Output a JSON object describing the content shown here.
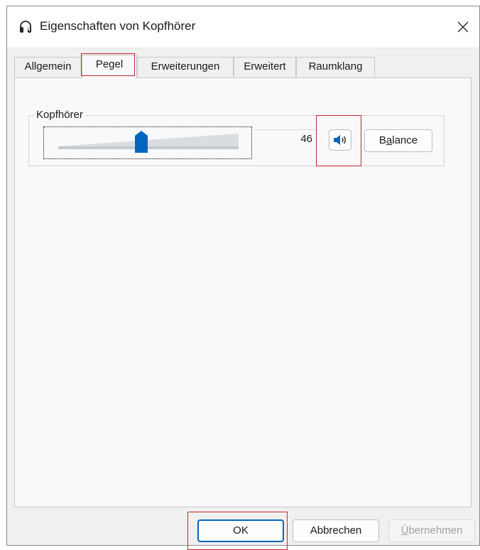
{
  "window": {
    "title": "Eigenschaften von Kopfhörer",
    "title_icon": "headphones-icon",
    "close_icon": "close-icon"
  },
  "tabs": [
    {
      "label": "Allgemein",
      "active": false
    },
    {
      "label": "Pegel",
      "active": true
    },
    {
      "label": "Erweiterungen",
      "active": false
    },
    {
      "label": "Erweitert",
      "active": false
    },
    {
      "label": "Raumklang",
      "active": false
    }
  ],
  "levels": {
    "group_label": "Kopfhörer",
    "volume": 46,
    "volume_text": "46",
    "mute_icon": "speaker-icon",
    "balance": {
      "pre": "B",
      "accel": "a",
      "post": "lance"
    }
  },
  "buttons": {
    "ok": "OK",
    "cancel": "Abbrechen",
    "apply": {
      "accel": "Ü",
      "post": "bernehmen"
    }
  },
  "colors": {
    "accent": "#0067c0",
    "highlight": "#c4262e",
    "track": "#d9dde1"
  }
}
